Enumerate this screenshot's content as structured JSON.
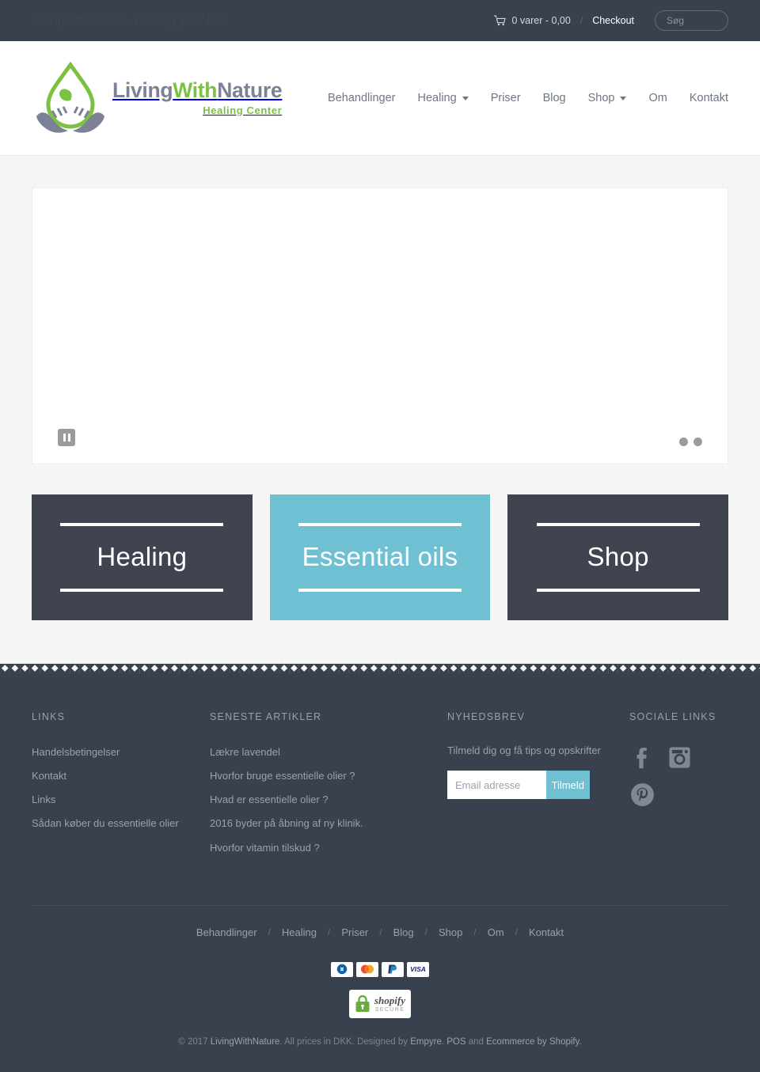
{
  "topbar": {
    "tagline": "Livingwithnature - healing your life",
    "cart_icon": "shopping-cart-icon",
    "cart_label": "0 varer - 0,00",
    "separator": "/",
    "checkout_label": "Checkout",
    "search_placeholder": "Søg",
    "search_value": ""
  },
  "header": {
    "logo": {
      "mark": "green-water-drop-leaf-in-hands-icon",
      "word_part1": "Living",
      "word_part2": "With",
      "word_part3": "Nature",
      "subtitle": "Healing Center"
    },
    "nav": [
      {
        "label": "Behandlinger",
        "dropdown": false
      },
      {
        "label": "Healing",
        "dropdown": true
      },
      {
        "label": "Priser",
        "dropdown": false
      },
      {
        "label": "Blog",
        "dropdown": false
      },
      {
        "label": "Shop",
        "dropdown": true
      },
      {
        "label": "Om",
        "dropdown": false
      },
      {
        "label": "Kontakt",
        "dropdown": false
      }
    ]
  },
  "slider": {
    "pause_icon": "pause-icon",
    "dots": 2,
    "active_dot": 1
  },
  "tiles": [
    {
      "label": "Healing",
      "style": "dark"
    },
    {
      "label": "Essential oils",
      "style": "teal"
    },
    {
      "label": "Shop",
      "style": "dark"
    }
  ],
  "footer": {
    "links": {
      "title": "LINKS",
      "items": [
        "Handelsbetingelser",
        "Kontakt",
        "Links",
        "Sådan køber du essentielle olier"
      ]
    },
    "articles": {
      "title": "SENESTE ARTIKLER",
      "items": [
        "Lækre lavendel",
        "Hvorfor bruge essentielle olier ?",
        "Hvad er essentielle olier ?",
        "2016 byder på åbning af ny klinik.",
        "Hvorfor vitamin tilskud ?"
      ]
    },
    "newsletter": {
      "title": "NYHEDSBREV",
      "description": "Tilmeld dig og få tips og opskrifter",
      "input_placeholder": "Email adresse",
      "input_value": "",
      "button_label": "Tilmeld"
    },
    "social": {
      "title": "SOCIALE LINKS",
      "items": [
        "facebook-icon",
        "instagram-icon",
        "pinterest-icon"
      ]
    },
    "bottom_nav": [
      "Behandlinger",
      "Healing",
      "Priser",
      "Blog",
      "Shop",
      "Om",
      "Kontakt"
    ],
    "bottom_nav_separator": "/",
    "payments": [
      "diners-club-icon",
      "mastercard-icon",
      "paypal-icon",
      "visa-icon"
    ],
    "badge": {
      "name": "shopify",
      "secure": "SECURE",
      "lock_icon": "green-lock-icon"
    },
    "copyright": {
      "prefix": "© 2017 ",
      "brand": "LivingWithNature",
      "mid": ". All prices in DKK. Designed by ",
      "designer": "Empyre",
      "mid2": ". ",
      "pos": "POS",
      "mid3": " and ",
      "ecommerce": "Ecommerce by Shopify",
      "suffix": "."
    }
  },
  "colors": {
    "dark": "#39414f",
    "tile_dark": "#3f4450",
    "teal": "#6fc0d3",
    "green": "#7cc142",
    "logo_gray": "#7c8195"
  }
}
